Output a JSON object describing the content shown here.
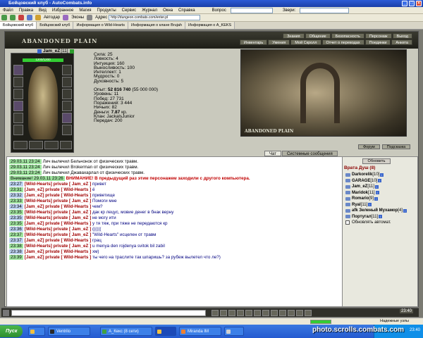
{
  "window": {
    "title": "Бойцовский клуб - AutoCombats.info"
  },
  "menu": {
    "items": [
      "Файл",
      "Правка",
      "Вид",
      "Избранное",
      "Магия",
      "Продукты",
      "Сервис",
      "Журнал",
      "Окна",
      "Справка"
    ],
    "search_label": "Вопрос",
    "search_value": "",
    "smiles_label": "Звери:",
    "smiles_value": ""
  },
  "toolbar": {
    "autodress_label": "Автодар",
    "autostrip_label": "Эконы",
    "address_label": "Адрес",
    "address_value": "http://dungeon.combats.com/enter.pl"
  },
  "tabs": [
    "Бойцовский клуб",
    "Бойцовский клуб",
    "Информация о Wild-Hearts",
    "Информация о клане Brujah",
    "Информация о A_KEKS"
  ],
  "game": {
    "logo": "ABANDONED PLAIN",
    "nav_top": [
      "Знания",
      "Общение",
      "Безопасность",
      "Персонаж",
      "Выход"
    ],
    "nav_bottom": [
      "Инвентарь",
      "Умения",
      "Мой Скролл",
      "Отчет о переводах",
      "Поединки",
      "Анкета"
    ],
    "hp_text": "1200/1200",
    "hp_fraction": 1.0,
    "char_name": "Jam_eZ",
    "char_level": "[11]",
    "stats": [
      "Сила: 25",
      "Ловкость: 4",
      "Интуиция: 160",
      "Выносливость: 100",
      "Интеллект: 1",
      "Мудрость: 0",
      "Духовность: 5"
    ],
    "exp_label": "Опыт:",
    "exp_value": "52 816 740",
    "exp_next": "(55 000 000)",
    "stats2": [
      "Уровень: 11",
      "Побед: 27 731",
      "Поражений: 3 444",
      "Ничьих: 82"
    ],
    "money_label": "Деньги:",
    "money_value": "7.87",
    "money_unit": "кр.",
    "clan": "Клан: JackalsJunior",
    "transfers": "Передач: 200",
    "arena_caption": "ABANDONED PLAIN",
    "forum_button": "Форум",
    "hint_button": "Подсказка"
  },
  "chat": {
    "tabs": [
      "Чат",
      "Системные сообщения"
    ],
    "messages": [
      {
        "ts": "29.03.11 23:24",
        "style": "sys",
        "text": "Лич вылечил Бельчонок от физических травм.",
        "bold": "Бельчонок"
      },
      {
        "ts": "29.03.11 23:24",
        "style": "sys",
        "text": "Лич вылечил Brokerman от физических травм.",
        "bold": "Brokerman"
      },
      {
        "ts": "29.03.11 23:24",
        "style": "sys",
        "text": "Лич вылечил Джавахарлал от физических травм.",
        "bold": "Джавахарлал"
      },
      {
        "ts": "Внимание! 29.03.11 23:26",
        "style": "warn",
        "text": "ВНИМАНИЕ! В предыдущий раз этим персонажем заходили с другого компьютера.",
        "bold": ""
      },
      {
        "ts": "23:27",
        "style": "pv",
        "pv": "[Wild-Hearts] private [ Jam_eZ ]",
        "text": "привет"
      },
      {
        "ts": "23:31",
        "style": "pv",
        "pv": "[Jam_eZ] private [ Wild-Hearts ]",
        "text": "ё"
      },
      {
        "ts": "23:32",
        "style": "pv",
        "pv": "[Jam_eZ] private [ Wild-Hearts ]",
        "text": "приветище"
      },
      {
        "ts": "23:33",
        "style": "pv",
        "pv": "[Wild-Hearts] private [ Jam_eZ ]",
        "text": "Помоги мне"
      },
      {
        "ts": "23:34",
        "style": "pv",
        "pv": "[Jam_eZ] private [ Wild-Hearts ]",
        "text": "чем?"
      },
      {
        "ts": "23:35",
        "style": "pv",
        "pv": "[Wild-Hearts] private [ Jam_eZ ]",
        "text": "дак кр лецус, мовие денег в бнак верну"
      },
      {
        "ts": "23:35",
        "style": "pv",
        "pv": "[Wild-Hearts] private [ Jam_eZ ]",
        "text": "не могу ити"
      },
      {
        "ts": "23:35",
        "style": "pv",
        "pv": "[Jam_eZ] private [ Wild-Hearts ]",
        "text": "у тя тяж, при тяже не передаются кр"
      },
      {
        "ts": "23:36",
        "style": "pv",
        "pv": "[Wild-Hearts] private [ Jam_eZ ]",
        "text": "(((((("
      },
      {
        "ts": "23:37",
        "style": "pv",
        "pv": "[Wild-Hearts] private [ Jam_eZ ]",
        "text": "\"Wild-Hearts\" исцелен от травм"
      },
      {
        "ts": "23:37",
        "style": "pv",
        "pv": "[Jam_eZ] private [ Wild-Hearts ]",
        "text": "грац"
      },
      {
        "ts": "23:38",
        "style": "pv",
        "pv": "[Wild-Hearts] private [ Jam_eZ ]",
        "text": "u menya den rojdenya svitok bil zabil"
      },
      {
        "ts": "23:38",
        "style": "pv",
        "pv": "[Jam_eZ] private [ Wild-Hearts ]",
        "text": "хм)"
      },
      {
        "ts": "23:39",
        "style": "pv",
        "pv": "[Jam_eZ] private [ Wild-Hearts ]",
        "text": "ты чего на траслите так шпаришь? за рубеж вылетел что ле?)"
      }
    ]
  },
  "online": {
    "refresh_label": "Обновить",
    "room": "Врата Душ (8)",
    "users": [
      {
        "name": "Darkorelik",
        "lvl": "[10]"
      },
      {
        "name": "GARAGE",
        "lvl": "[10]"
      },
      {
        "name": "Jam_eZ",
        "lvl": "[11]"
      },
      {
        "name": "Maridok",
        "lvl": "[11]"
      },
      {
        "name": "Romario",
        "lvl": "[9]"
      },
      {
        "name": "Ryal",
        "lvl": "[11]"
      },
      {
        "name": "afk Зеленый Мухамор",
        "lvl": "[4]"
      },
      {
        "name": "Португал",
        "lvl": "[11]"
      }
    ],
    "auto_label": "Обновлять автомат."
  },
  "bottom": {
    "clock": "23:40"
  },
  "statusbar": {
    "left": "",
    "right": "Надежные узлы"
  },
  "taskbar": {
    "start": "Пуск",
    "tasks": [
      "",
      "Ventrilo",
      "A_Кекс (8 сети)",
      "",
      "Miranda IM",
      ""
    ],
    "time": "23:40"
  },
  "watermark": "photo.scrolls.combats.com"
}
